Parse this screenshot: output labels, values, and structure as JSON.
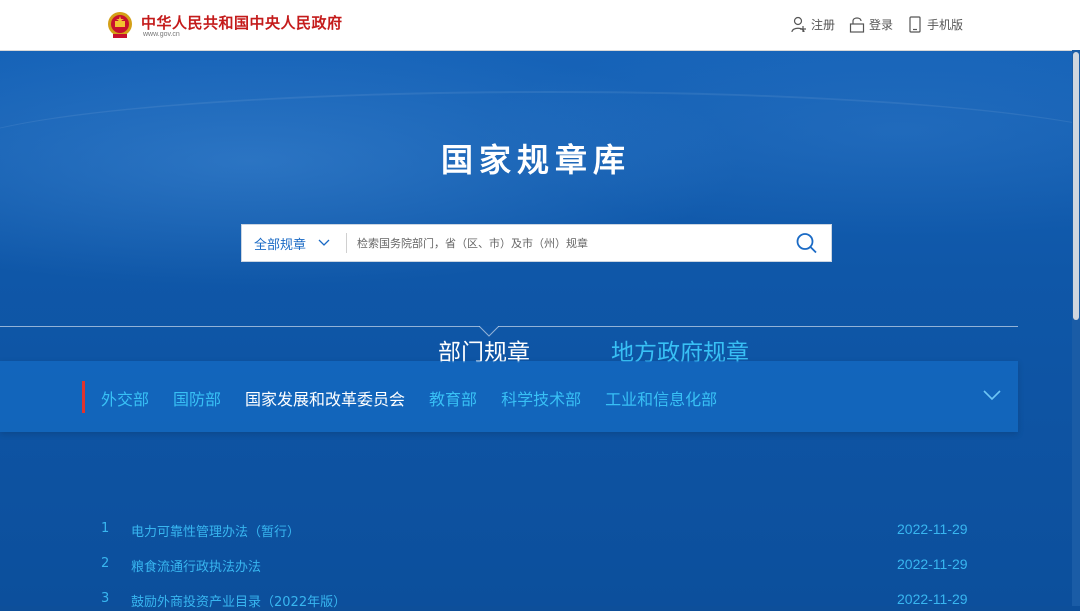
{
  "header": {
    "site_title": "中华人民共和国中央人民政府",
    "site_url": "www.gov.cn",
    "links": [
      {
        "label": "注册",
        "icon": "user-add-icon"
      },
      {
        "label": "登录",
        "icon": "lock-icon"
      },
      {
        "label": "手机版",
        "icon": "mobile-icon"
      }
    ]
  },
  "hero": {
    "title": "国家规章库"
  },
  "search": {
    "scope_label": "全部规章",
    "placeholder": "检索国务院部门，省（区、市）及市（州）规章"
  },
  "tabs": [
    {
      "label": "部门规章",
      "active": true
    },
    {
      "label": "地方政府规章",
      "active": false
    }
  ],
  "categories": [
    {
      "label": "外交部",
      "active": false
    },
    {
      "label": "国防部",
      "active": false
    },
    {
      "label": "国家发展和改革委员会",
      "active": true
    },
    {
      "label": "教育部",
      "active": false
    },
    {
      "label": "科学技术部",
      "active": false
    },
    {
      "label": "工业和信息化部",
      "active": false
    }
  ],
  "regulations": [
    {
      "num": "1",
      "title": "电力可靠性管理办法（暂行）",
      "date": "2022-11-29"
    },
    {
      "num": "2",
      "title": "粮食流通行政执法办法",
      "date": "2022-11-29"
    },
    {
      "num": "3",
      "title": "鼓励外商投资产业目录（2022年版）",
      "date": "2022-11-29"
    }
  ],
  "colors": {
    "brand_red": "#c41b1b",
    "hero_blue": "#0f57a8",
    "accent_cyan": "#38c0f5"
  }
}
